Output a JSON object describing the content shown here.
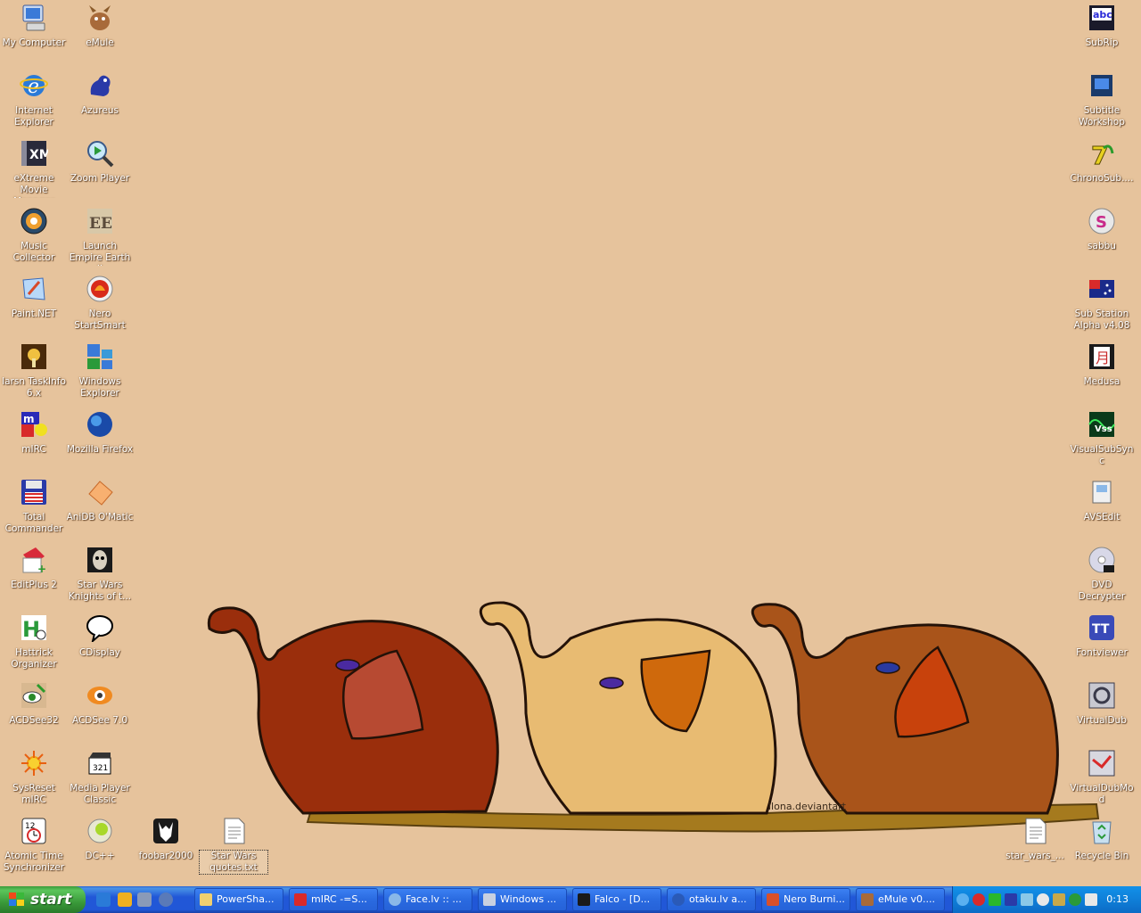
{
  "desktop": {
    "left_col1": [
      "My Computer",
      "Internet Explorer",
      "eXtreme Movie Manager",
      "Music Collector",
      "Paint.NET",
      "Iarsn TaskInfo 6.x",
      "mIRC",
      "Total Commander",
      "EditPlus 2",
      "Hattrick Organizer",
      "ACDSee32",
      "SysReset mIRC",
      "Atomic Time Synchronizer"
    ],
    "left_col2": [
      "eMule",
      "Azureus",
      "Zoom Player",
      "Launch Empire Earth II",
      "Nero StartSmart",
      "Windows Explorer",
      "Mozilla Firefox",
      "AniDB O'Matic",
      "Star Wars Knights of t...",
      "CDisplay",
      "ACDSee 7.0",
      "Media Player Classic",
      "DC++"
    ],
    "bottom_extra": [
      "foobar2000",
      "Star Wars quotes.txt"
    ],
    "right_col": [
      "SubRip",
      "Subtitle Workshop",
      "ChronoSub....",
      "sabbu",
      "Sub Station Alpha v4.08",
      "Medusa",
      "VisualSubSync",
      "AVSEdit",
      "DVD Decrypter",
      "Fontviewer",
      "VirtualDub",
      "VirtualDubMod",
      "Recycle Bin"
    ],
    "right_extra": "star_wars_...",
    "watermark": "ilona.deviantart"
  },
  "taskbar": {
    "start_label": "start",
    "buttons": [
      "PowerSha...",
      "mIRC -=S...",
      "Face.lv :: ...",
      "Windows ...",
      "Falco - [D...",
      "otaku.lv a...",
      "Nero Burni...",
      "eMule v0...."
    ],
    "clock": "0:13"
  },
  "colors": {
    "desktop": "#e6c39c",
    "taskbar": "#2157d7",
    "start": "#3a9a3a",
    "tray": "#0f7fd8"
  }
}
